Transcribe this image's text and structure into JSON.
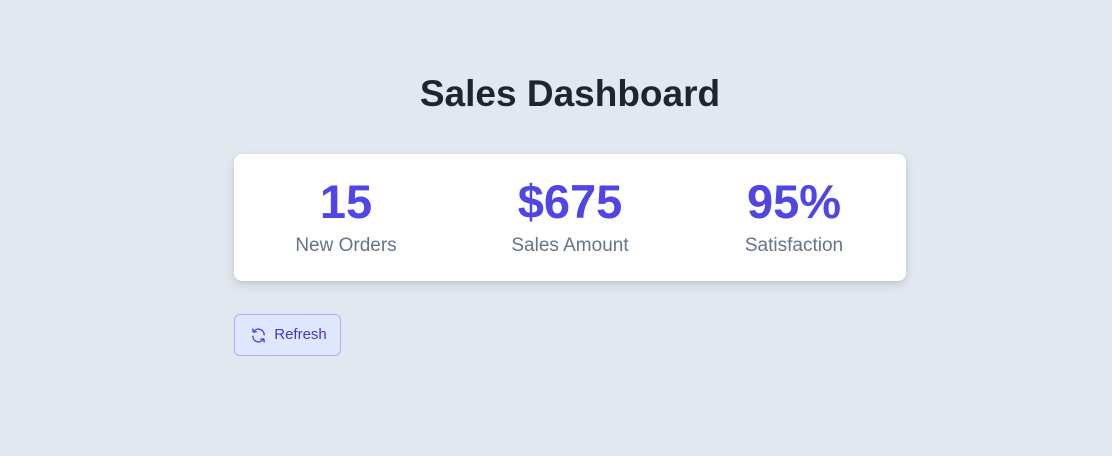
{
  "header": {
    "title": "Sales Dashboard"
  },
  "stats": [
    {
      "value": "15",
      "label": "New Orders"
    },
    {
      "value": "$675",
      "label": "Sales Amount"
    },
    {
      "value": "95%",
      "label": "Satisfaction"
    }
  ],
  "actions": {
    "refresh_label": "Refresh",
    "refresh_icon": "refresh-icon"
  },
  "colors": {
    "background": "#e2e8f0",
    "accent": "#5046e5",
    "muted_text": "#64748b",
    "title_text": "#1e2430",
    "button_bg": "#e0e7ff",
    "button_text": "#4338ca"
  }
}
